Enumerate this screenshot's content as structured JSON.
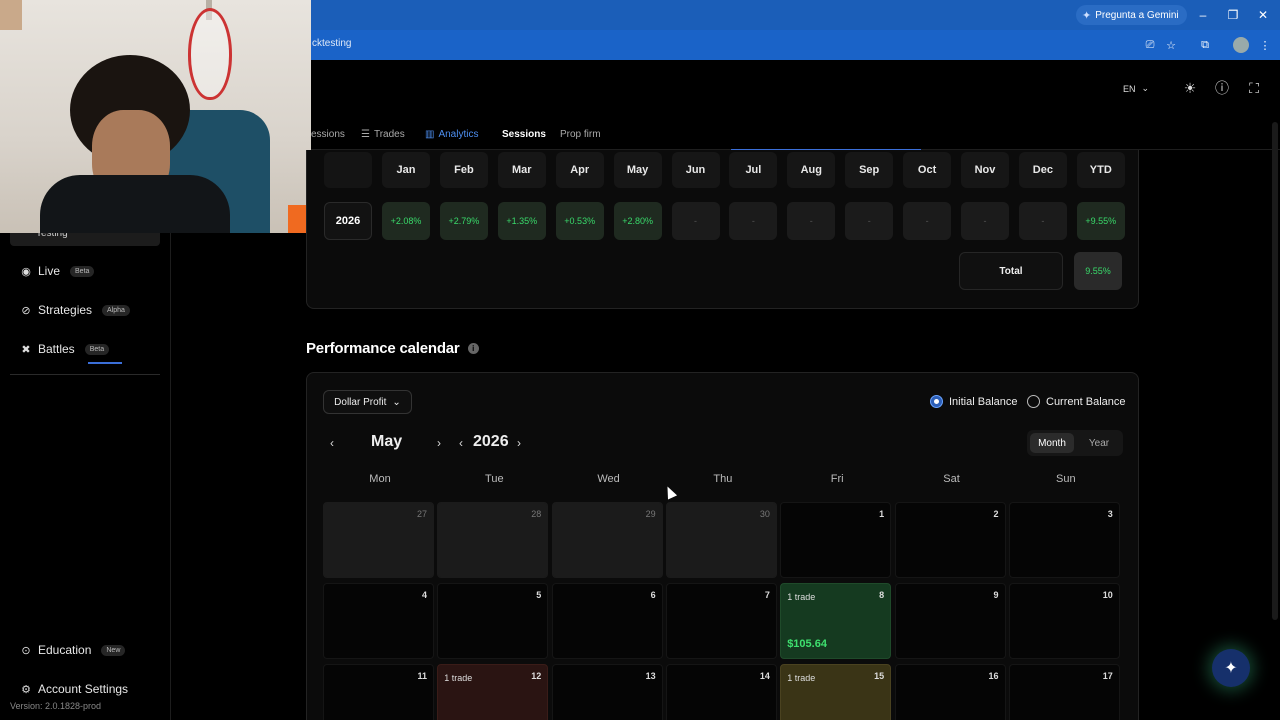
{
  "browser": {
    "gemini_label": "Pregunta a Gemini",
    "url_fragment": "cktesting"
  },
  "header": {
    "language": "EN"
  },
  "sidebar": {
    "items": [
      {
        "label": "Testing",
        "icon": "flask-icon"
      },
      {
        "label": "Live",
        "badge": "Beta",
        "icon": "record-icon"
      },
      {
        "label": "Strategies",
        "badge": "Alpha",
        "icon": "compass-icon"
      },
      {
        "label": "Battles",
        "badge": "Beta",
        "icon": "swords-icon"
      }
    ],
    "bottom": [
      {
        "label": "Education",
        "badge": "New",
        "icon": "graduation-icon"
      },
      {
        "label": "Account Settings",
        "icon": "gear-icon"
      }
    ],
    "version": "Version: 2.0.1828-prod"
  },
  "tabs": [
    {
      "label": "essions"
    },
    {
      "label": "Trades"
    },
    {
      "label": "Analytics"
    },
    {
      "label": "Sessions"
    },
    {
      "label": "Prop firm"
    }
  ],
  "monthly": {
    "months": [
      "Jan",
      "Feb",
      "Mar",
      "Apr",
      "May",
      "Jun",
      "Jul",
      "Aug",
      "Sep",
      "Oct",
      "Nov",
      "Dec",
      "YTD"
    ],
    "year": "2026",
    "values": [
      "+2.08%",
      "+2.79%",
      "+1.35%",
      "+0.53%",
      "+2.80%",
      "-",
      "-",
      "-",
      "-",
      "-",
      "-",
      "-",
      "+9.55%"
    ],
    "total_label": "Total",
    "total_value": "9.55%"
  },
  "calendar": {
    "title": "Performance calendar",
    "metric_dropdown": "Dollar Profit",
    "balance_options": [
      "Initial Balance",
      "Current Balance"
    ],
    "selected_balance": "Initial Balance",
    "month": "May",
    "year": "2026",
    "view_options": [
      "Month",
      "Year"
    ],
    "selected_view": "Month",
    "weekdays": [
      "Mon",
      "Tue",
      "Wed",
      "Thu",
      "Fri",
      "Sat",
      "Sun"
    ],
    "week1": [
      "27",
      "28",
      "29",
      "30",
      "1",
      "2",
      "3"
    ],
    "week2": [
      "4",
      "5",
      "6",
      "7",
      "8",
      "9",
      "10"
    ],
    "week3": [
      "11",
      "12",
      "13",
      "14",
      "15",
      "16",
      "17"
    ],
    "trade_label": "1 trade",
    "may8_amount": "$105.64"
  },
  "colors": {
    "accent": "#3b6fd9",
    "profit": "#39d96a",
    "win_cell": "#153a20",
    "loss_cell": "#2a1412",
    "neutral_cell": "#3a3416"
  }
}
